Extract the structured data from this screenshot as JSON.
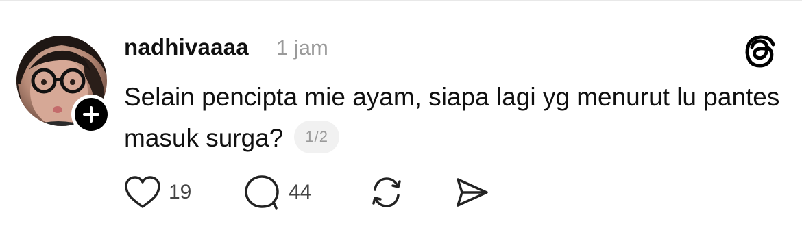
{
  "post": {
    "username": "nadhivaaaa",
    "time": "1 jam",
    "text": "Selain pencipta mie ayam, siapa lagi yg menurut lu pantes masuk surga?",
    "page_indicator": "1/2"
  },
  "actions": {
    "likes": "19",
    "replies": "44"
  },
  "icons": [
    "avatar",
    "plus-icon",
    "threads-logo-icon",
    "heart-icon",
    "comment-icon",
    "repost-icon",
    "share-icon"
  ],
  "colors": {
    "text": "#101010",
    "muted": "#9a9a9a",
    "badge_bg": "#f1f1f1",
    "follow_badge": "#000000"
  }
}
